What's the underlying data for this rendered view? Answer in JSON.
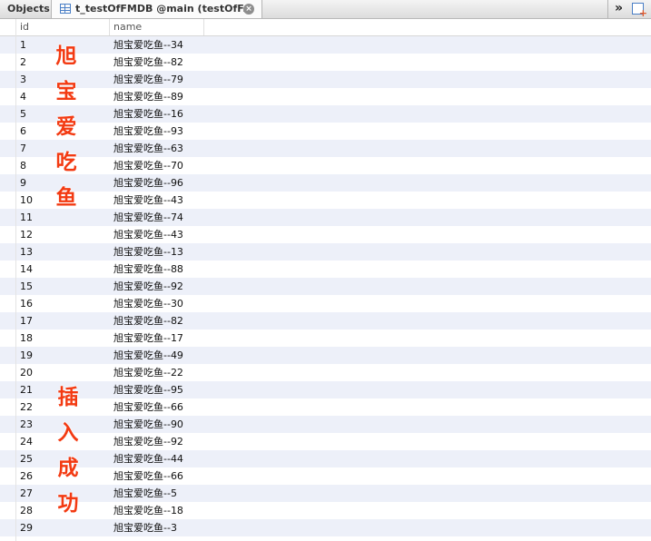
{
  "tabs": {
    "objects_label": "Objects",
    "table_label": "t_testOfFMDB @main (testOfF...",
    "close_glyph": "×",
    "overflow_glyph": "»"
  },
  "table": {
    "columns": [
      "id",
      "name"
    ],
    "rows": [
      {
        "id": "1",
        "name": "旭宝爱吃鱼--34"
      },
      {
        "id": "2",
        "name": "旭宝爱吃鱼--82"
      },
      {
        "id": "3",
        "name": "旭宝爱吃鱼--79"
      },
      {
        "id": "4",
        "name": "旭宝爱吃鱼--89"
      },
      {
        "id": "5",
        "name": "旭宝爱吃鱼--16"
      },
      {
        "id": "6",
        "name": "旭宝爱吃鱼--93"
      },
      {
        "id": "7",
        "name": "旭宝爱吃鱼--63"
      },
      {
        "id": "8",
        "name": "旭宝爱吃鱼--70"
      },
      {
        "id": "9",
        "name": "旭宝爱吃鱼--96"
      },
      {
        "id": "10",
        "name": "旭宝爱吃鱼--43"
      },
      {
        "id": "11",
        "name": "旭宝爱吃鱼--74"
      },
      {
        "id": "12",
        "name": "旭宝爱吃鱼--43"
      },
      {
        "id": "13",
        "name": "旭宝爱吃鱼--13"
      },
      {
        "id": "14",
        "name": "旭宝爱吃鱼--88"
      },
      {
        "id": "15",
        "name": "旭宝爱吃鱼--92"
      },
      {
        "id": "16",
        "name": "旭宝爱吃鱼--30"
      },
      {
        "id": "17",
        "name": "旭宝爱吃鱼--82"
      },
      {
        "id": "18",
        "name": "旭宝爱吃鱼--17"
      },
      {
        "id": "19",
        "name": "旭宝爱吃鱼--49"
      },
      {
        "id": "20",
        "name": "旭宝爱吃鱼--22"
      },
      {
        "id": "21",
        "name": "旭宝爱吃鱼--95"
      },
      {
        "id": "22",
        "name": "旭宝爱吃鱼--66"
      },
      {
        "id": "23",
        "name": "旭宝爱吃鱼--90"
      },
      {
        "id": "24",
        "name": "旭宝爱吃鱼--92"
      },
      {
        "id": "25",
        "name": "旭宝爱吃鱼--44"
      },
      {
        "id": "26",
        "name": "旭宝爱吃鱼--66"
      },
      {
        "id": "27",
        "name": "旭宝爱吃鱼--5"
      },
      {
        "id": "28",
        "name": "旭宝爱吃鱼--18"
      },
      {
        "id": "29",
        "name": "旭宝爱吃鱼--3"
      }
    ]
  },
  "annotations": {
    "top": [
      "旭",
      "宝",
      "爱",
      "吃",
      "鱼"
    ],
    "bottom": [
      "插",
      "入",
      "成",
      "功"
    ],
    "color": "#f33a12"
  },
  "icons": {
    "table_icon": "table-icon",
    "close_icon": "close-icon",
    "overflow_icon": "chevron-double-right-icon",
    "newtab_icon": "add-query-icon"
  },
  "colors": {
    "row_stripe": "#edf0f9",
    "accent_blue": "#4a7fc6"
  }
}
